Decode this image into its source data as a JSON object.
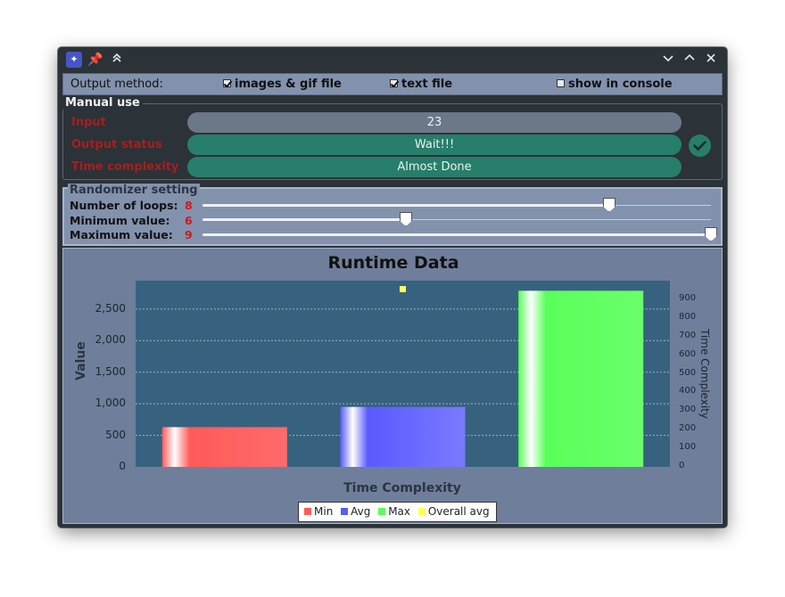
{
  "window": {
    "title_icons": [
      "app-icon",
      "pin-icon",
      "keep-above-icon"
    ],
    "controls": [
      "minimize-icon",
      "maximize-icon",
      "close-icon"
    ]
  },
  "output": {
    "label": "Output method:",
    "options": [
      {
        "label": "images & gif file",
        "checked": true
      },
      {
        "label": "text file",
        "checked": true
      },
      {
        "label": "show in console",
        "checked": false
      }
    ]
  },
  "manual": {
    "title": "Manual use",
    "input_label": "Input",
    "input_value": "23",
    "status_label": "Output status",
    "status_value": "Wait!!!",
    "complexity_label": "Time complexity",
    "complexity_value": "Almost Done"
  },
  "randomizer": {
    "title": "Randomizer setting",
    "loops_label": "Number of loops:",
    "loops_value": "8",
    "min_label": "Minimum value:",
    "min_value": "6",
    "max_label": "Maximum value:",
    "max_value": "9",
    "loops_level": 0.8,
    "min_level": 0.4,
    "max_level": 1.0
  },
  "chart_data": {
    "type": "bar",
    "title": "Runtime Data",
    "xlabel": "Time Complexity",
    "ylabel": "Value",
    "y2label": "Time Complexity",
    "categories": [
      "Min",
      "Avg",
      "Max"
    ],
    "values": [
      630,
      950,
      2790
    ],
    "colors": [
      "#ff5a5a",
      "#5a5aff",
      "#5aff5a"
    ],
    "overall_avg": 2790,
    "overall_avg_color": "#ffff55",
    "ylim": [
      0,
      2950
    ],
    "yticks": [
      "0",
      "500",
      "1,000",
      "1,500",
      "2,000",
      "2,500"
    ],
    "ytick_values": [
      0,
      500,
      1000,
      1500,
      2000,
      2500
    ],
    "y2ticks": [
      "0",
      "100",
      "200",
      "300",
      "400",
      "500",
      "600",
      "700",
      "800",
      "900"
    ],
    "y2_max": 1000,
    "legend": [
      "Min",
      "Avg",
      "Max",
      "Overall avg"
    ],
    "grid": "horizontal"
  }
}
